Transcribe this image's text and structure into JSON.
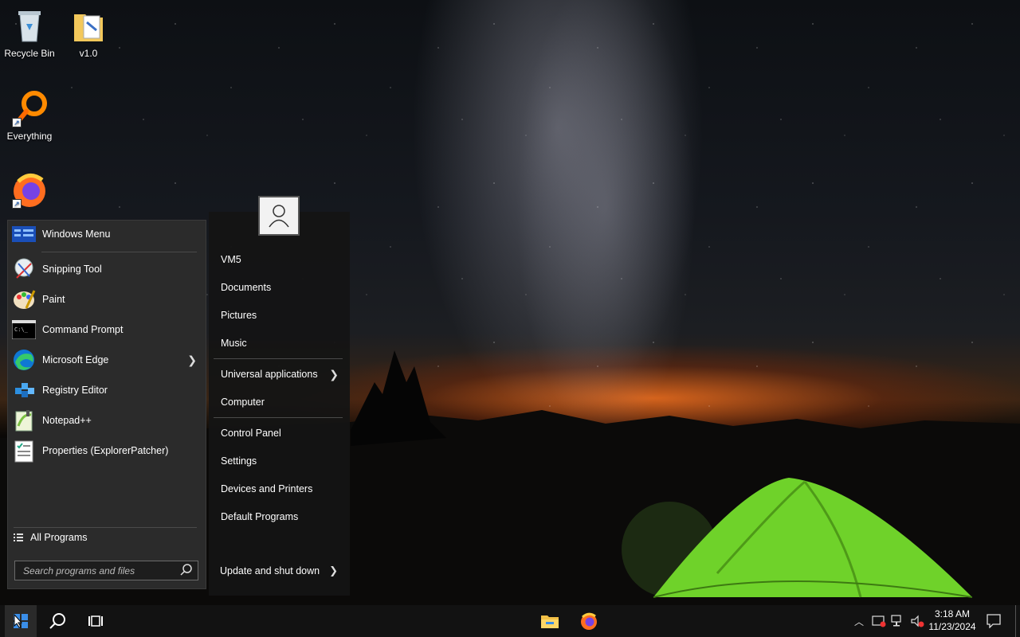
{
  "desktop": {
    "icons": [
      {
        "label": "Recycle Bin",
        "icon": "recycle-bin-icon"
      },
      {
        "label": "v1.0",
        "icon": "folder-icon"
      },
      {
        "label": "Everything",
        "icon": "everything-search-icon"
      },
      {
        "label": "",
        "icon": "firefox-icon"
      }
    ]
  },
  "start_menu": {
    "pinned": [
      {
        "label": "Windows Menu",
        "icon": "windows-menu-icon"
      },
      {
        "label": "Snipping Tool",
        "icon": "snipping-tool-icon"
      },
      {
        "label": "Paint",
        "icon": "paint-icon"
      },
      {
        "label": "Command Prompt",
        "icon": "command-prompt-icon"
      },
      {
        "label": "Microsoft Edge",
        "icon": "edge-icon",
        "submenu": true
      },
      {
        "label": "Registry Editor",
        "icon": "registry-editor-icon"
      },
      {
        "label": "Notepad++",
        "icon": "notepad-plus-plus-icon"
      },
      {
        "label": "Properties (ExplorerPatcher)",
        "icon": "properties-icon"
      }
    ],
    "all_programs": "All Programs",
    "search_placeholder": "Search programs and files",
    "places": [
      {
        "label": "VM5"
      },
      {
        "label": "Documents"
      },
      {
        "label": "Pictures"
      },
      {
        "label": "Music"
      },
      {
        "label": "Universal applications",
        "submenu": true
      },
      {
        "label": "Computer"
      },
      {
        "label": "Control Panel"
      },
      {
        "label": "Settings"
      },
      {
        "label": "Devices and Printers"
      },
      {
        "label": "Default Programs"
      }
    ],
    "shutdown_label": "Update and shut down"
  },
  "taskbar": {
    "clock_time": "3:18 AM",
    "clock_date": "11/23/2024"
  }
}
